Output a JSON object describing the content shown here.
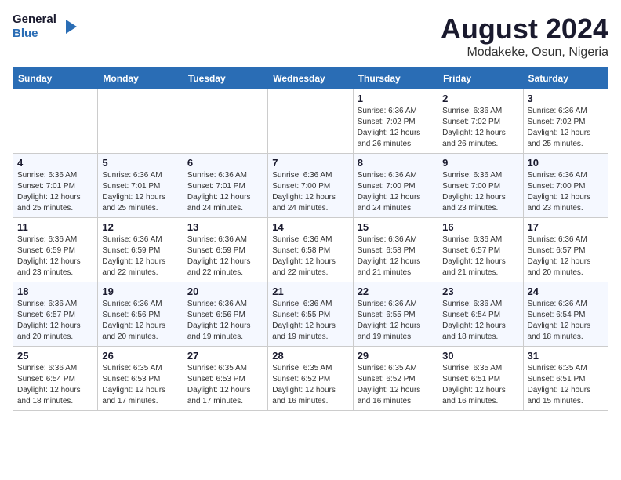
{
  "header": {
    "logo_line1": "General",
    "logo_line2": "Blue",
    "month_year": "August 2024",
    "location": "Modakeke, Osun, Nigeria"
  },
  "weekdays": [
    "Sunday",
    "Monday",
    "Tuesday",
    "Wednesday",
    "Thursday",
    "Friday",
    "Saturday"
  ],
  "weeks": [
    [
      {
        "day": "",
        "info": ""
      },
      {
        "day": "",
        "info": ""
      },
      {
        "day": "",
        "info": ""
      },
      {
        "day": "",
        "info": ""
      },
      {
        "day": "1",
        "info": "Sunrise: 6:36 AM\nSunset: 7:02 PM\nDaylight: 12 hours\nand 26 minutes."
      },
      {
        "day": "2",
        "info": "Sunrise: 6:36 AM\nSunset: 7:02 PM\nDaylight: 12 hours\nand 26 minutes."
      },
      {
        "day": "3",
        "info": "Sunrise: 6:36 AM\nSunset: 7:02 PM\nDaylight: 12 hours\nand 25 minutes."
      }
    ],
    [
      {
        "day": "4",
        "info": "Sunrise: 6:36 AM\nSunset: 7:01 PM\nDaylight: 12 hours\nand 25 minutes."
      },
      {
        "day": "5",
        "info": "Sunrise: 6:36 AM\nSunset: 7:01 PM\nDaylight: 12 hours\nand 25 minutes."
      },
      {
        "day": "6",
        "info": "Sunrise: 6:36 AM\nSunset: 7:01 PM\nDaylight: 12 hours\nand 24 minutes."
      },
      {
        "day": "7",
        "info": "Sunrise: 6:36 AM\nSunset: 7:00 PM\nDaylight: 12 hours\nand 24 minutes."
      },
      {
        "day": "8",
        "info": "Sunrise: 6:36 AM\nSunset: 7:00 PM\nDaylight: 12 hours\nand 24 minutes."
      },
      {
        "day": "9",
        "info": "Sunrise: 6:36 AM\nSunset: 7:00 PM\nDaylight: 12 hours\nand 23 minutes."
      },
      {
        "day": "10",
        "info": "Sunrise: 6:36 AM\nSunset: 7:00 PM\nDaylight: 12 hours\nand 23 minutes."
      }
    ],
    [
      {
        "day": "11",
        "info": "Sunrise: 6:36 AM\nSunset: 6:59 PM\nDaylight: 12 hours\nand 23 minutes."
      },
      {
        "day": "12",
        "info": "Sunrise: 6:36 AM\nSunset: 6:59 PM\nDaylight: 12 hours\nand 22 minutes."
      },
      {
        "day": "13",
        "info": "Sunrise: 6:36 AM\nSunset: 6:59 PM\nDaylight: 12 hours\nand 22 minutes."
      },
      {
        "day": "14",
        "info": "Sunrise: 6:36 AM\nSunset: 6:58 PM\nDaylight: 12 hours\nand 22 minutes."
      },
      {
        "day": "15",
        "info": "Sunrise: 6:36 AM\nSunset: 6:58 PM\nDaylight: 12 hours\nand 21 minutes."
      },
      {
        "day": "16",
        "info": "Sunrise: 6:36 AM\nSunset: 6:57 PM\nDaylight: 12 hours\nand 21 minutes."
      },
      {
        "day": "17",
        "info": "Sunrise: 6:36 AM\nSunset: 6:57 PM\nDaylight: 12 hours\nand 20 minutes."
      }
    ],
    [
      {
        "day": "18",
        "info": "Sunrise: 6:36 AM\nSunset: 6:57 PM\nDaylight: 12 hours\nand 20 minutes."
      },
      {
        "day": "19",
        "info": "Sunrise: 6:36 AM\nSunset: 6:56 PM\nDaylight: 12 hours\nand 20 minutes."
      },
      {
        "day": "20",
        "info": "Sunrise: 6:36 AM\nSunset: 6:56 PM\nDaylight: 12 hours\nand 19 minutes."
      },
      {
        "day": "21",
        "info": "Sunrise: 6:36 AM\nSunset: 6:55 PM\nDaylight: 12 hours\nand 19 minutes."
      },
      {
        "day": "22",
        "info": "Sunrise: 6:36 AM\nSunset: 6:55 PM\nDaylight: 12 hours\nand 19 minutes."
      },
      {
        "day": "23",
        "info": "Sunrise: 6:36 AM\nSunset: 6:54 PM\nDaylight: 12 hours\nand 18 minutes."
      },
      {
        "day": "24",
        "info": "Sunrise: 6:36 AM\nSunset: 6:54 PM\nDaylight: 12 hours\nand 18 minutes."
      }
    ],
    [
      {
        "day": "25",
        "info": "Sunrise: 6:36 AM\nSunset: 6:54 PM\nDaylight: 12 hours\nand 18 minutes."
      },
      {
        "day": "26",
        "info": "Sunrise: 6:35 AM\nSunset: 6:53 PM\nDaylight: 12 hours\nand 17 minutes."
      },
      {
        "day": "27",
        "info": "Sunrise: 6:35 AM\nSunset: 6:53 PM\nDaylight: 12 hours\nand 17 minutes."
      },
      {
        "day": "28",
        "info": "Sunrise: 6:35 AM\nSunset: 6:52 PM\nDaylight: 12 hours\nand 16 minutes."
      },
      {
        "day": "29",
        "info": "Sunrise: 6:35 AM\nSunset: 6:52 PM\nDaylight: 12 hours\nand 16 minutes."
      },
      {
        "day": "30",
        "info": "Sunrise: 6:35 AM\nSunset: 6:51 PM\nDaylight: 12 hours\nand 16 minutes."
      },
      {
        "day": "31",
        "info": "Sunrise: 6:35 AM\nSunset: 6:51 PM\nDaylight: 12 hours\nand 15 minutes."
      }
    ]
  ]
}
